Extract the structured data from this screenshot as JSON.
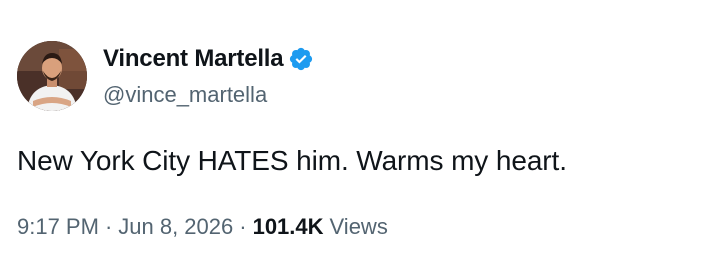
{
  "author": {
    "display_name": "Vincent Martella",
    "handle": "@vince_martella",
    "verified_badge_color": "#1d9bf0",
    "avatar_icon": "profile-photo"
  },
  "tweet": {
    "text": "New York City HATES him. Warms my heart.",
    "time": "9:17 PM",
    "date": "Jun 8, 2026",
    "separator": "·",
    "views_count": "101.4K",
    "views_label": "Views"
  }
}
